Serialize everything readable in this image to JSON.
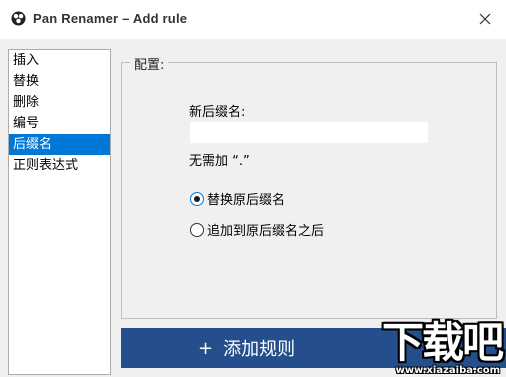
{
  "window": {
    "title": "Pan Renamer – Add rule",
    "app_icon": "pan-renamer-logo-icon",
    "close_icon": "close-icon"
  },
  "rule_list": {
    "items": [
      {
        "label": "插入",
        "selected": false
      },
      {
        "label": "替换",
        "selected": false
      },
      {
        "label": "删除",
        "selected": false
      },
      {
        "label": "编号",
        "selected": false
      },
      {
        "label": "后缀名",
        "selected": true
      },
      {
        "label": "正则表达式",
        "selected": false
      }
    ]
  },
  "config": {
    "group_title": "配置:",
    "new_ext_label": "新后缀名:",
    "new_ext_value": "",
    "hint": "无需加 “.”",
    "options": [
      {
        "label": "替换原后缀名",
        "checked": true
      },
      {
        "label": "追加到原后缀名之后",
        "checked": false
      }
    ]
  },
  "add_button": {
    "icon": "+",
    "label": "添加规则"
  },
  "watermark": {
    "main": "下载吧",
    "sub": "www.xiazaiba.com"
  },
  "colors": {
    "selection": "#0078d7",
    "button": "#254f8c",
    "panel_bg": "#f0f0f0"
  }
}
